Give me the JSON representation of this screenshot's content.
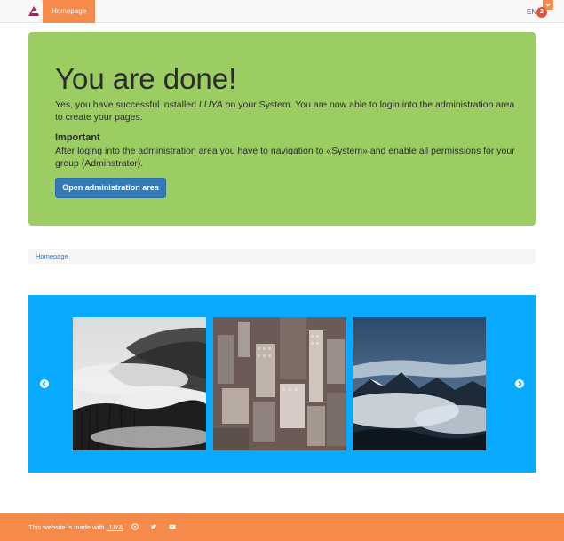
{
  "navbar": {
    "logo_icon": "luya-logo-icon",
    "home_label": "Homepage",
    "language": "EN",
    "notification_count": "2",
    "accent_color": "#f58a4b",
    "badge_color": "#e0523c"
  },
  "jumbotron": {
    "title": "You are done!",
    "paragraph_before": "Yes, you have successful installed ",
    "paragraph_emphasis": "LUYA",
    "paragraph_after": " on your System. You are now able to login into the administration area to create your pages.",
    "important_heading": "Important",
    "important_text": "After loging into the administration area you have to navigation to «System» and enable all permissions for your group (Adminstrator).",
    "button_label": "Open administration area",
    "background_color": "#9ccd63",
    "button_color": "#337ab7"
  },
  "breadcrumb": {
    "items": [
      "Homepage"
    ]
  },
  "carousel": {
    "background_color": "#07aaff",
    "slides": [
      {
        "icon": "misty-forest-photo"
      },
      {
        "icon": "city-skyline-photo"
      },
      {
        "icon": "mountain-clouds-photo"
      }
    ],
    "prev_icon": "chevron-left-icon",
    "next_icon": "chevron-right-icon"
  },
  "footer": {
    "text_prefix": "This website is made with ",
    "link_label": "LUYA",
    "icons": [
      "github-icon",
      "twitter-icon",
      "youtube-icon"
    ],
    "background_color": "#f58a4b"
  }
}
